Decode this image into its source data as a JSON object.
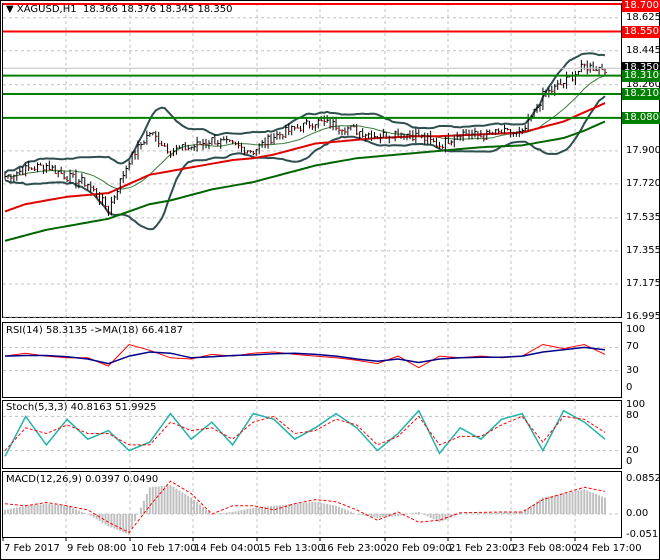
{
  "header": {
    "symbol": "XAGUSD,H1",
    "ohlc": "18.366 18.376 18.345 18.350"
  },
  "colors": {
    "resistance": "#ff0000",
    "support": "#008000",
    "ma_fast": "#e00000",
    "ma_slow": "#006400",
    "bollinger": "#2f4f4f",
    "rsi": "#ff0000",
    "rsi_ma": "#00008b",
    "stoch_main": "#20b2aa",
    "stoch_signal": "#ff0000",
    "macd_hist": "#c0c0c0",
    "macd_signal": "#ff0000"
  },
  "chart_data": [
    {
      "type": "line",
      "panel": "price",
      "title": "XAGUSD,H1",
      "ylim": [
        16.995,
        18.7
      ],
      "y_ticks": [
        "18.625",
        "18.445",
        "18.260",
        "17.900",
        "17.720",
        "17.535",
        "17.355",
        "17.175",
        "16.995"
      ],
      "x_tick_labels": [
        "7 Feb 2017",
        "9 Feb 08:00",
        "10 Feb 17:00",
        "14 Feb 04:00",
        "15 Feb 13:00",
        "16 Feb 23:00",
        "20 Feb 09:00",
        "21 Feb 23:00",
        "23 Feb 08:00",
        "24 Feb 17:00"
      ],
      "close": [
        17.76,
        17.8,
        17.82,
        17.76,
        17.72,
        17.58,
        17.85,
        18.0,
        17.9,
        17.92,
        17.96,
        17.93,
        17.9,
        17.98,
        18.02,
        18.06,
        18.04,
        18.01,
        17.98,
        18.0,
        17.98,
        17.93,
        18.0,
        17.98,
        18.0,
        17.99,
        18.2,
        18.27,
        18.36,
        18.35
      ],
      "ma_fast": [
        17.57,
        17.61,
        17.63,
        17.65,
        17.66,
        17.67,
        17.72,
        17.77,
        17.79,
        17.81,
        17.83,
        17.85,
        17.86,
        17.88,
        17.91,
        17.94,
        17.95,
        17.96,
        17.97,
        17.975,
        17.98,
        17.98,
        17.985,
        17.99,
        17.995,
        18.0,
        18.03,
        18.06,
        18.11,
        18.16
      ],
      "ma_slow": [
        17.41,
        17.44,
        17.47,
        17.49,
        17.51,
        17.53,
        17.57,
        17.61,
        17.63,
        17.66,
        17.69,
        17.71,
        17.73,
        17.76,
        17.79,
        17.82,
        17.84,
        17.86,
        17.87,
        17.88,
        17.89,
        17.9,
        17.91,
        17.92,
        17.925,
        17.93,
        17.95,
        17.97,
        18.01,
        18.06
      ],
      "levels": [
        {
          "value": "18.700",
          "kind": "resistance"
        },
        {
          "value": "18.550",
          "kind": "resistance"
        },
        {
          "value": "18.310",
          "kind": "support"
        },
        {
          "value": "18.210",
          "kind": "support"
        },
        {
          "value": "18.080",
          "kind": "support"
        }
      ],
      "current_price": "18.350"
    },
    {
      "type": "line",
      "panel": "rsi",
      "title": "RSI(14) 58.3135  ->MA(18) 66.4187",
      "ylim": [
        0,
        100
      ],
      "y_ticks": [
        "100",
        "70",
        "30",
        "0"
      ],
      "rsi": [
        55,
        60,
        55,
        52,
        52,
        38,
        75,
        65,
        52,
        50,
        58,
        55,
        60,
        62,
        58,
        55,
        52,
        48,
        42,
        55,
        35,
        55,
        52,
        55,
        52,
        55,
        75,
        68,
        75,
        58
      ],
      "ma": [
        55,
        56,
        56,
        54,
        50,
        42,
        55,
        62,
        60,
        52,
        54,
        56,
        57,
        59,
        60,
        58,
        55,
        50,
        46,
        50,
        44,
        50,
        52,
        53,
        53,
        55,
        62,
        66,
        70,
        66
      ]
    },
    {
      "type": "line",
      "panel": "stoch",
      "title": "Stoch(5,3,3) 40.8163 51.9925",
      "ylim": [
        0,
        100
      ],
      "y_ticks": [
        "100",
        "80",
        "20",
        "0"
      ],
      "main": [
        10,
        80,
        30,
        75,
        40,
        55,
        20,
        35,
        85,
        40,
        70,
        30,
        85,
        75,
        40,
        60,
        85,
        60,
        20,
        50,
        90,
        15,
        60,
        40,
        75,
        85,
        20,
        90,
        70,
        40
      ],
      "signal": [
        20,
        60,
        50,
        65,
        50,
        50,
        30,
        30,
        70,
        55,
        60,
        40,
        70,
        80,
        50,
        55,
        75,
        65,
        30,
        45,
        80,
        30,
        45,
        45,
        65,
        80,
        35,
        80,
        75,
        52
      ]
    },
    {
      "type": "bar",
      "panel": "macd",
      "title": "MACD(12,26,9) 0.0397 0.0490",
      "ylim": [
        -0.0511,
        0.0852
      ],
      "y_ticks": [
        "0.0852",
        "0.00",
        "-0.0511"
      ],
      "histogram": [
        0.01,
        0.02,
        0.025,
        0.02,
        0.0,
        -0.03,
        -0.05,
        0.065,
        0.07,
        0.04,
        0.0,
        0.005,
        0.015,
        0.02,
        0.025,
        0.03,
        0.02,
        0.0,
        -0.01,
        -0.005,
        0.005,
        -0.02,
        0.0,
        0.002,
        0.003,
        0.005,
        0.04,
        0.05,
        0.06,
        0.04
      ],
      "signal": [
        0.025,
        0.02,
        0.028,
        0.02,
        0.01,
        -0.02,
        -0.045,
        0.02,
        0.08,
        0.05,
        0.0,
        0.02,
        0.02,
        0.01,
        0.025,
        0.035,
        0.03,
        0.01,
        -0.015,
        0.005,
        -0.02,
        -0.015,
        0.003,
        0.004,
        0.005,
        0.005,
        0.035,
        0.05,
        0.065,
        0.055
      ]
    }
  ]
}
